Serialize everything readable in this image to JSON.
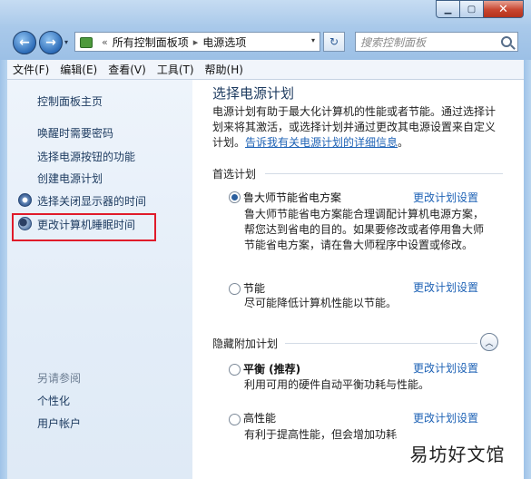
{
  "window": {
    "controls": {
      "minimize": "▁",
      "maximize": "▢",
      "close": "✕"
    }
  },
  "nav": {
    "back_glyph": "←",
    "forward_glyph": "→",
    "history_glyph": "▾"
  },
  "address": {
    "separator": "«",
    "crumbs": [
      "所有控制面板项",
      "电源选项"
    ],
    "crumb_separator": "▸",
    "dropdown_glyph": "▾",
    "refresh_glyph": "↻"
  },
  "search": {
    "placeholder": "搜索控制面板"
  },
  "menu": [
    "文件(F)",
    "编辑(E)",
    "查看(V)",
    "工具(T)",
    "帮助(H)"
  ],
  "sidebar": {
    "home": "控制面板主页",
    "links": [
      "唤醒时需要密码",
      "选择电源按钮的功能",
      "创建电源计划",
      "选择关闭显示器的时间",
      "更改计算机睡眠时间"
    ],
    "see_also_title": "另请参阅",
    "see_also": [
      "个性化",
      "用户帐户"
    ]
  },
  "main": {
    "title": "选择电源计划",
    "desc_text": "电源计划有助于最大化计算机的性能或者节能。通过选择计划来将其激活，或选择计划并通过更改其电源设置来自定义计划。",
    "desc_link": "告诉我有关电源计划的详细信息",
    "desc_end": "。",
    "preferred_label": "首选计划",
    "hidden_label": "隐藏附加计划",
    "collapse_glyph": "︿",
    "change_label": "更改计划设置",
    "plans": [
      {
        "name": "鲁大师节能省电方案",
        "selected": true,
        "desc": "鲁大师节能省电方案能合理调配计算机电源方案，帮您达到省电的目的。如果要修改或者停用鲁大师节能省电方案，请在鲁大师程序中设置或修改。"
      },
      {
        "name": "节能",
        "selected": false,
        "desc": "尽可能降低计算机性能以节能。"
      },
      {
        "name": "平衡 (推荐)",
        "selected": false,
        "desc": "利用可用的硬件自动平衡功耗与性能。"
      },
      {
        "name": "高性能",
        "selected": false,
        "desc": "有利于提高性能，但会增加功耗"
      }
    ]
  },
  "watermark": "易坊好文馆"
}
